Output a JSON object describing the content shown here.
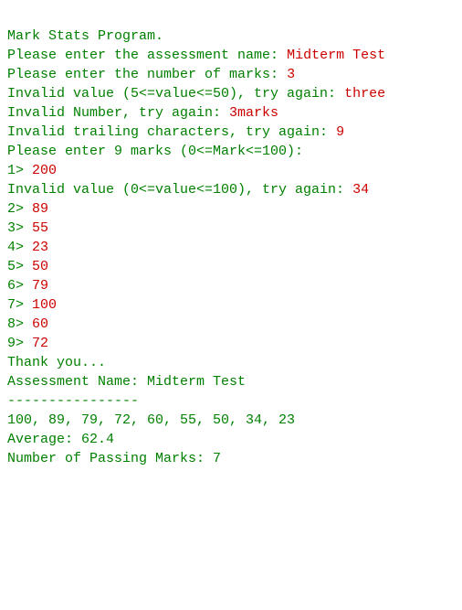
{
  "lines": [
    {
      "prompt": "Mark Stats Program.",
      "input": null
    },
    {
      "prompt": "",
      "input": null
    },
    {
      "prompt": "Please enter the assessment name: ",
      "input": "Midterm Test"
    },
    {
      "prompt": "Please enter the number of marks: ",
      "input": "3"
    },
    {
      "prompt": "Invalid value (5<=value<=50), try again: ",
      "input": "three"
    },
    {
      "prompt": "Invalid Number, try again: ",
      "input": "3marks"
    },
    {
      "prompt": "Invalid trailing characters, try again: ",
      "input": "9"
    },
    {
      "prompt": "Please enter 9 marks (0<=Mark<=100):",
      "input": null
    },
    {
      "prompt": "1> ",
      "input": "200"
    },
    {
      "prompt": "Invalid value (0<=value<=100), try again: ",
      "input": "34"
    },
    {
      "prompt": "2> ",
      "input": "89"
    },
    {
      "prompt": "3> ",
      "input": "55"
    },
    {
      "prompt": "4> ",
      "input": "23"
    },
    {
      "prompt": "5> ",
      "input": "50"
    },
    {
      "prompt": "6> ",
      "input": "79"
    },
    {
      "prompt": "7> ",
      "input": "100"
    },
    {
      "prompt": "8> ",
      "input": "60"
    },
    {
      "prompt": "9> ",
      "input": "72"
    },
    {
      "prompt": "Thank you...",
      "input": null
    },
    {
      "prompt": "Assessment Name: Midterm Test",
      "input": null
    },
    {
      "prompt": "----------------",
      "input": null
    },
    {
      "prompt": "100, 89, 79, 72, 60, 55, 50, 34, 23",
      "input": null
    },
    {
      "prompt": "Average: 62.4",
      "input": null
    },
    {
      "prompt": "Number of Passing Marks: 7",
      "input": null
    }
  ]
}
